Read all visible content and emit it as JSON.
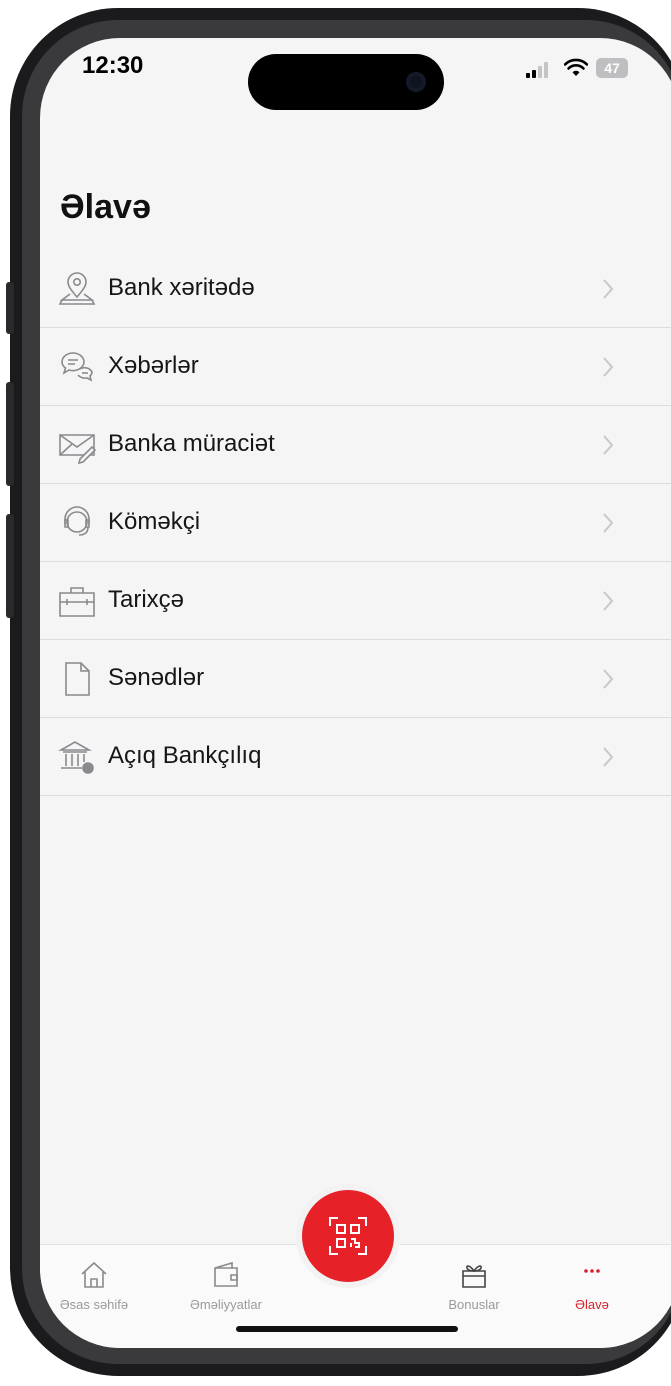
{
  "status_bar": {
    "time": "12:30",
    "battery": "47"
  },
  "page": {
    "title": "Əlavə"
  },
  "menu": {
    "items": [
      {
        "label": "Bank xəritədə",
        "icon": "map-pin-icon"
      },
      {
        "label": "Xəbərlər",
        "icon": "chat-bubbles-icon"
      },
      {
        "label": "Banka müraciət",
        "icon": "envelope-pen-icon"
      },
      {
        "label": "Köməkçi",
        "icon": "headset-icon"
      },
      {
        "label": "Tarixçə",
        "icon": "briefcase-icon"
      },
      {
        "label": "Sənədlər",
        "icon": "document-icon"
      },
      {
        "label": "Açıq Bankçılıq",
        "icon": "bank-building-icon"
      }
    ]
  },
  "tabbar": {
    "tabs": [
      {
        "label": "Əsas səhifə",
        "icon": "home-icon",
        "active": false
      },
      {
        "label": "Əməliyyatlar",
        "icon": "wallet-icon",
        "active": false
      },
      {
        "label": "Bonuslar",
        "icon": "gift-icon",
        "active": false
      },
      {
        "label": "Əlavə",
        "icon": "more-dots-icon",
        "active": true
      }
    ],
    "center_button_icon": "qr-scan-icon"
  },
  "colors": {
    "accent": "#e62228",
    "active_tab": "#d8222a",
    "icon_gray": "#8a8a8e",
    "background": "#f5f5f6"
  }
}
